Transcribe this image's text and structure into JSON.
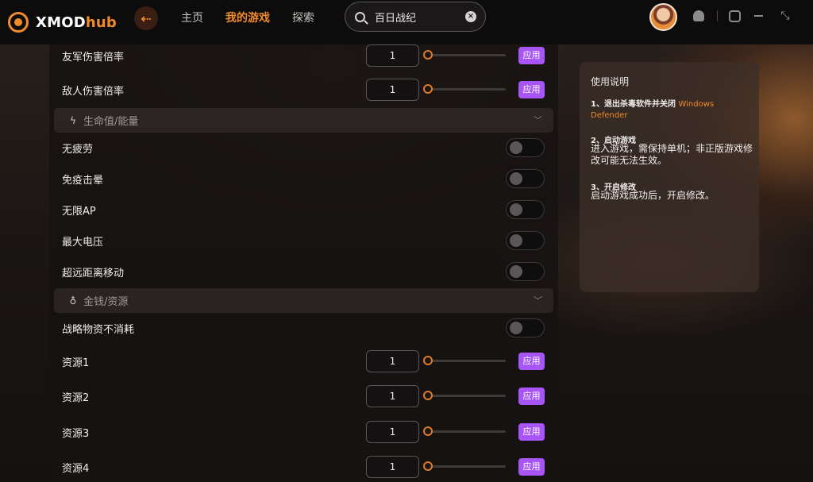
{
  "app": {
    "name_a": "XMOD",
    "name_b": "hub"
  },
  "nav": {
    "back_icon": "arrow-left",
    "items": [
      "主页",
      "我的游戏",
      "探索"
    ],
    "active_index": 1
  },
  "search": {
    "value": "百日战纪",
    "clear_icon": "close"
  },
  "header_icons": [
    "avatar",
    "bell-icon",
    "settings-icon",
    "minimize-icon",
    "fullscreen-icon"
  ],
  "colors": {
    "accent": "#f08a2a",
    "apply": "#a855f7"
  },
  "mods": {
    "top_rows": [
      {
        "label": "友军伤害倍率",
        "value": "1",
        "apply": "应用",
        "slider": 0
      },
      {
        "label": "敌人伤害倍率",
        "value": "1",
        "apply": "应用",
        "slider": 0
      }
    ],
    "section_life": {
      "icon": "lightning-icon",
      "label": "生命值/能量"
    },
    "life_toggles": [
      {
        "label": "无疲劳",
        "on": false
      },
      {
        "label": "免疫击晕",
        "on": false
      },
      {
        "label": "无限AP",
        "on": false
      },
      {
        "label": "最大电压",
        "on": false
      },
      {
        "label": "超远距离移动",
        "on": false
      }
    ],
    "section_money": {
      "icon": "money-bag-icon",
      "label": "金钱/资源"
    },
    "money_toggles": [
      {
        "label": "战略物资不消耗",
        "on": false
      }
    ],
    "resource_rows": [
      {
        "label": "资源1",
        "value": "1",
        "apply": "应用",
        "slider": 0
      },
      {
        "label": "资源2",
        "value": "1",
        "apply": "应用",
        "slider": 0
      },
      {
        "label": "资源3",
        "value": "1",
        "apply": "应用",
        "slider": 0
      },
      {
        "label": "资源4",
        "value": "1",
        "apply": "应用",
        "slider": 0
      }
    ]
  },
  "instructions": {
    "title": "使用说明",
    "step1_title": "1、退出杀毒软件并关闭",
    "step1_link": "Windows Defender",
    "step2_title": "2、启动游戏",
    "step2_text": "进入游戏，需保持单机；非正版游戏修改可能无法生效。",
    "step3_title": "3、开启修改",
    "step3_text": "启动游戏成功后，开启修改。"
  }
}
